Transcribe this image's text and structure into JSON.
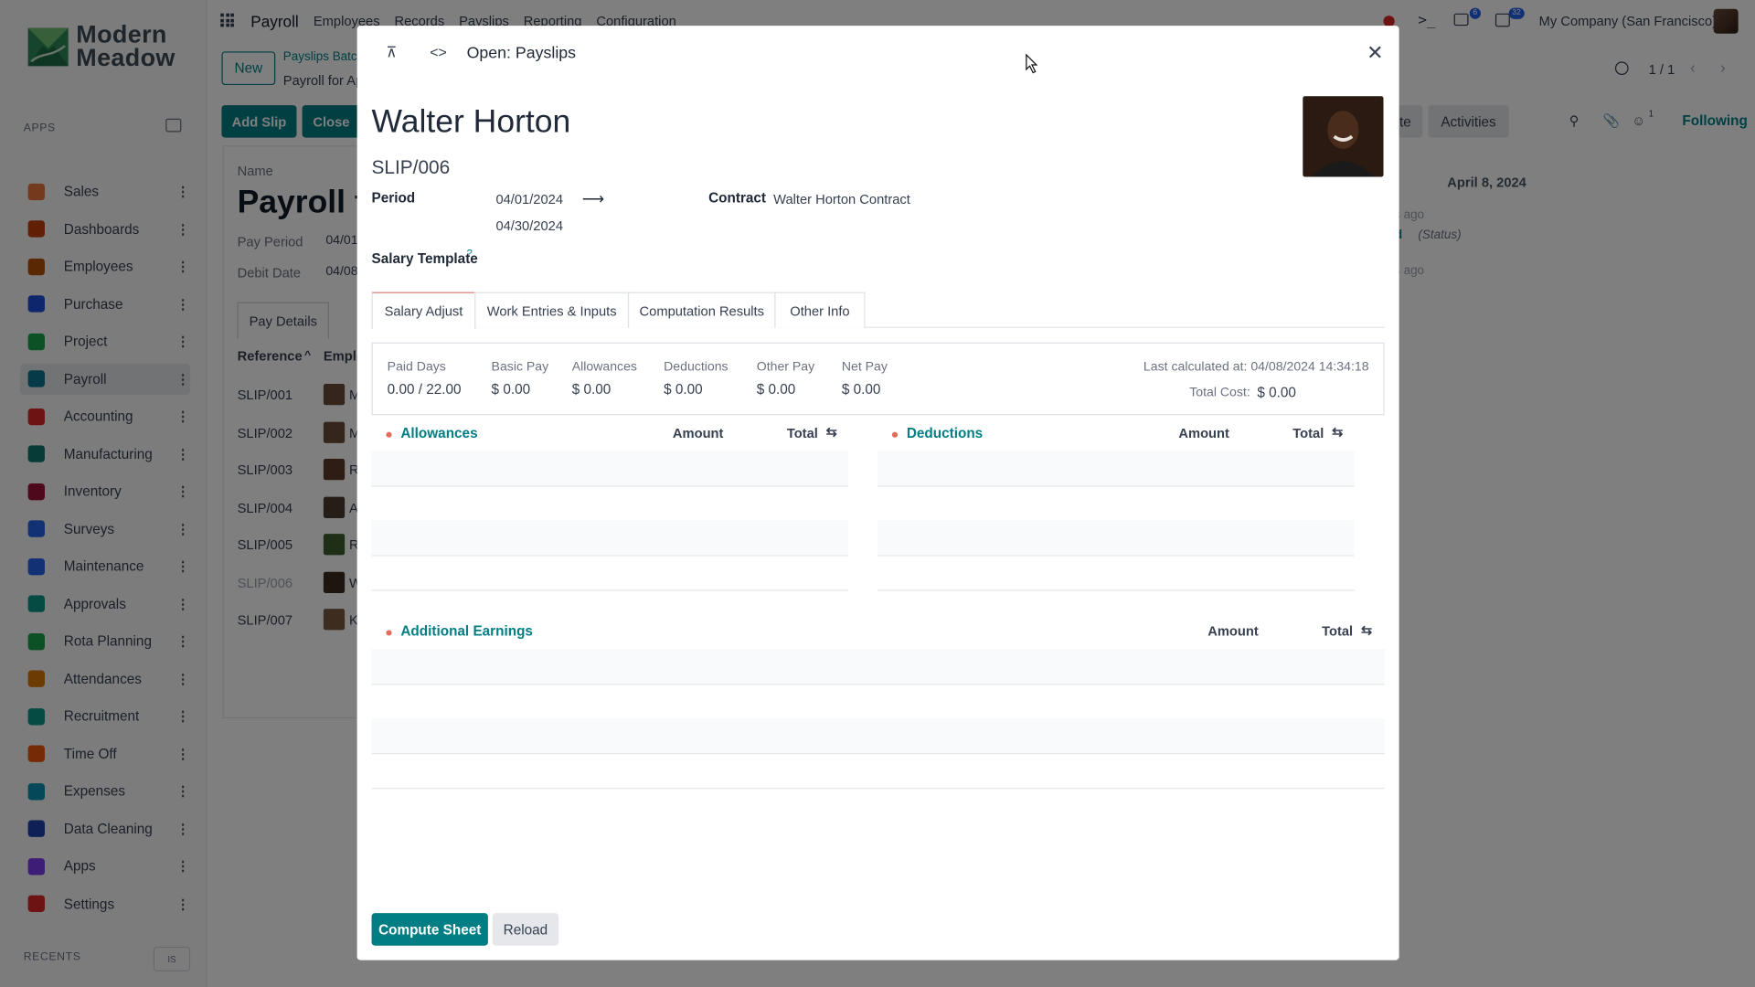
{
  "brand": {
    "line1": "Modern",
    "line2": "Meadow"
  },
  "sidebar": {
    "apps_heading": "APPS",
    "items": [
      {
        "label": "Sales",
        "icon": "sales-icon",
        "color": "#e8743b"
      },
      {
        "label": "Dashboards",
        "icon": "dashboards-icon",
        "color": "#c2410c"
      },
      {
        "label": "Employees",
        "icon": "employees-icon",
        "color": "#b45309"
      },
      {
        "label": "Purchase",
        "icon": "purchase-icon",
        "color": "#1d4ed8"
      },
      {
        "label": "Project",
        "icon": "project-icon",
        "color": "#16a34a"
      },
      {
        "label": "Payroll",
        "icon": "payroll-icon",
        "color": "#0e7490"
      },
      {
        "label": "Accounting",
        "icon": "accounting-icon",
        "color": "#dc2626"
      },
      {
        "label": "Manufacturing",
        "icon": "manufacturing-icon",
        "color": "#0f766e"
      },
      {
        "label": "Inventory",
        "icon": "inventory-icon",
        "color": "#9f1239"
      },
      {
        "label": "Surveys",
        "icon": "surveys-icon",
        "color": "#2563eb"
      },
      {
        "label": "Maintenance",
        "icon": "maintenance-icon",
        "color": "#2563eb"
      },
      {
        "label": "Approvals",
        "icon": "approvals-icon",
        "color": "#0d9488"
      },
      {
        "label": "Rota Planning",
        "icon": "rota-planning-icon",
        "color": "#16a34a"
      },
      {
        "label": "Attendances",
        "icon": "attendances-icon",
        "color": "#d97706"
      },
      {
        "label": "Recruitment",
        "icon": "recruitment-icon",
        "color": "#0d9488"
      },
      {
        "label": "Time Off",
        "icon": "time-off-icon",
        "color": "#ea580c"
      },
      {
        "label": "Expenses",
        "icon": "expenses-icon",
        "color": "#0891b2"
      },
      {
        "label": "Data Cleaning",
        "icon": "data-cleaning-icon",
        "color": "#1e40af"
      },
      {
        "label": "Apps",
        "icon": "apps-icon",
        "color": "#7c3aed"
      },
      {
        "label": "Settings",
        "icon": "settings-icon",
        "color": "#dc2626"
      }
    ],
    "recents_heading": "RECENTS",
    "recents_button": "IS"
  },
  "topnav": {
    "app_name": "Payroll",
    "menu": [
      "Employees",
      "Records",
      "Payslips",
      "Reporting",
      "Configuration"
    ],
    "chat_badge": "6",
    "activity_badge": "32",
    "company": "My Company (San Francisco)"
  },
  "control_panel": {
    "new_label": "New",
    "breadcrumb_parent": "Payslips Batch",
    "breadcrumb_current": "Payroll for Ap",
    "pager": "1 / 1",
    "add_slip": "Add Slip",
    "close": "Close",
    "note_tail": "te",
    "activities": "Activities",
    "following": "Following",
    "followers_count": "1"
  },
  "background_form": {
    "name_label": "Name",
    "title": "Payroll fo",
    "pay_period_label": "Pay Period",
    "pay_period_value": "04/01",
    "debit_date_label": "Debit Date",
    "debit_date_value": "04/08",
    "tab_label": "Pay Details",
    "col_reference": "Reference",
    "col_employee": "Emplo",
    "rows": [
      "SLIP/001",
      "SLIP/002",
      "SLIP/003",
      "SLIP/004",
      "SLIP/005",
      "SLIP/006",
      "SLIP/007"
    ],
    "row_initials": [
      "M",
      "M",
      "R",
      "A",
      "R",
      "W",
      "K"
    ]
  },
  "chatter": {
    "date": "April 8, 2024",
    "line1": "ys ago",
    "line2_bold": "ed",
    "line2_status": "(Status)",
    "line3": "ys ago"
  },
  "modal": {
    "title": "Open: Payslips",
    "employee_name": "Walter Horton",
    "slip_number": "SLIP/006",
    "period_label": "Period",
    "period_start": "04/01/2024",
    "period_end": "04/30/2024",
    "contract_label": "Contract",
    "contract_value": "Walter Horton Contract",
    "salary_template_label": "Salary Template",
    "help_mark": "?",
    "tabs": [
      "Salary Adjust",
      "Work Entries & Inputs",
      "Computation Results",
      "Other Info"
    ],
    "summary": {
      "paid_days_label": "Paid Days",
      "paid_days_value": "0.00 / 22.00",
      "basic_pay_label": "Basic Pay",
      "basic_pay_value": "$ 0.00",
      "allowances_label": "Allowances",
      "allowances_value": "$ 0.00",
      "deductions_label": "Deductions",
      "deductions_value": "$ 0.00",
      "other_pay_label": "Other Pay",
      "other_pay_value": "$ 0.00",
      "net_pay_label": "Net Pay",
      "net_pay_value": "$ 0.00",
      "last_calc": "Last calculated at: 04/08/2024 14:34:18",
      "total_cost_label": "Total Cost:",
      "total_cost_value": "$ 0.00"
    },
    "allowances_title": "Allowances",
    "deductions_title": "Deductions",
    "additional_title": "Additional Earnings",
    "col_amount": "Amount",
    "col_total": "Total",
    "compute_label": "Compute Sheet",
    "reload_label": "Reload"
  }
}
